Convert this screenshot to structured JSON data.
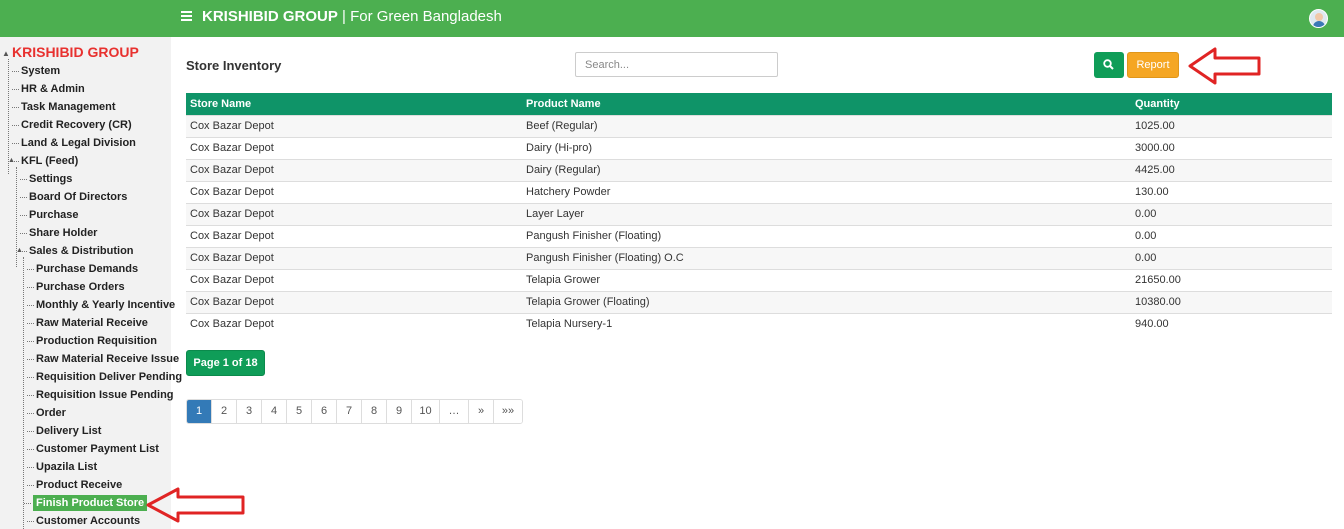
{
  "header": {
    "brand": "KRISHIBID GROUP",
    "separator": "|",
    "tagline": "For Green Bangladesh"
  },
  "sidebar": {
    "brand": "KRISHIBID GROUP",
    "items": [
      {
        "label": "System"
      },
      {
        "label": "HR & Admin"
      },
      {
        "label": "Task Management"
      },
      {
        "label": "Credit Recovery (CR)"
      },
      {
        "label": "Land & Legal Division"
      },
      {
        "label": "KFL (Feed)"
      },
      {
        "label": "Settings"
      },
      {
        "label": "Board Of Directors"
      },
      {
        "label": "Purchase"
      },
      {
        "label": "Share Holder"
      },
      {
        "label": "Sales & Distribution"
      },
      {
        "label": "Purchase Demands"
      },
      {
        "label": "Purchase Orders"
      },
      {
        "label": "Monthly & Yearly Incentive"
      },
      {
        "label": "Raw Material Receive"
      },
      {
        "label": "Production Requisition"
      },
      {
        "label": "Raw Material Receive Issue"
      },
      {
        "label": "Requisition Deliver Pending"
      },
      {
        "label": "Requisition Issue Pending"
      },
      {
        "label": "Order"
      },
      {
        "label": "Delivery List"
      },
      {
        "label": "Customer Payment List"
      },
      {
        "label": "Upazila List"
      },
      {
        "label": "Product Receive"
      },
      {
        "label": "Finish Product Store"
      },
      {
        "label": "Customer Accounts"
      }
    ],
    "active_item": "Finish Product Store"
  },
  "main": {
    "title": "Store Inventory",
    "search_placeholder": "Search...",
    "report_label": "Report",
    "table": {
      "headers": [
        "Store Name",
        "Product Name",
        "Quantity"
      ],
      "rows": [
        [
          "Cox Bazar Depot",
          "Beef (Regular)",
          "1025.00"
        ],
        [
          "Cox Bazar Depot",
          "Dairy (Hi-pro)",
          "3000.00"
        ],
        [
          "Cox Bazar Depot",
          "Dairy (Regular)",
          "4425.00"
        ],
        [
          "Cox Bazar Depot",
          "Hatchery Powder",
          "130.00"
        ],
        [
          "Cox Bazar Depot",
          "Layer Layer",
          "0.00"
        ],
        [
          "Cox Bazar Depot",
          "Pangush Finisher (Floating)",
          "0.00"
        ],
        [
          "Cox Bazar Depot",
          "Pangush Finisher (Floating) O.C",
          "0.00"
        ],
        [
          "Cox Bazar Depot",
          "Telapia Grower",
          "21650.00"
        ],
        [
          "Cox Bazar Depot",
          "Telapia Grower (Floating)",
          "10380.00"
        ],
        [
          "Cox Bazar Depot",
          "Telapia Nursery-1",
          "940.00"
        ]
      ]
    },
    "page_info": "Page 1 of 18",
    "pagination": [
      "1",
      "2",
      "3",
      "4",
      "5",
      "6",
      "7",
      "8",
      "9",
      "10",
      "…",
      "»",
      "»»"
    ],
    "current_page": "1"
  },
  "colors": {
    "topbar": "#4caf50",
    "table_header": "#0f9468",
    "primary_button": "#0f9d58",
    "report_button": "#f5a623",
    "brand_red": "#e8312f",
    "annotation_arrow": "#e02424",
    "active_page": "#337ab7"
  },
  "icons": {
    "menu": "hamburger-icon",
    "search": "search-icon",
    "avatar": "user-avatar",
    "annotation": "red-outline-arrow-icon"
  }
}
